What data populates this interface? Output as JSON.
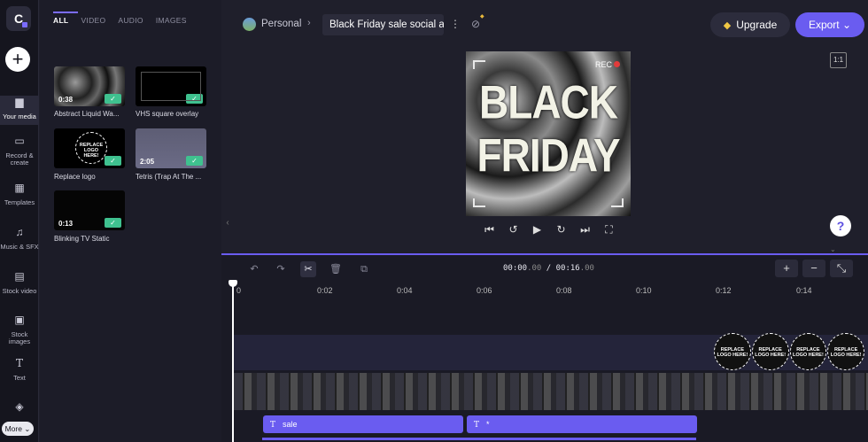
{
  "rail": {
    "logo": "C",
    "items": [
      {
        "label": "Your media",
        "icon": "folder-icon"
      },
      {
        "label": "Record & create",
        "icon": "camera-icon"
      },
      {
        "label": "Templates",
        "icon": "grid-icon"
      },
      {
        "label": "Music & SFX",
        "icon": "music-icon"
      },
      {
        "label": "Stock video",
        "icon": "film-icon"
      },
      {
        "label": "Stock images",
        "icon": "image-icon"
      },
      {
        "label": "Text",
        "icon": "text-icon"
      },
      {
        "label": "",
        "icon": "shapes-icon"
      }
    ],
    "more": "More ⌄"
  },
  "panel": {
    "tabs": [
      "ALL",
      "VIDEO",
      "AUDIO",
      "IMAGES"
    ],
    "media": [
      {
        "name": "Abstract Liquid Wa...",
        "duration": "0:38"
      },
      {
        "name": "VHS square overlay",
        "duration": ""
      },
      {
        "name": "Replace logo",
        "duration": "",
        "overlay": "REPLACE LOGO HERE!"
      },
      {
        "name": "Tetris (Trap At The ...",
        "duration": "2:05"
      },
      {
        "name": "Blinking TV Static",
        "duration": "0:13"
      }
    ]
  },
  "topbar": {
    "project": "Personal",
    "crumb_sep": "›",
    "title": "Black Friday sale social a",
    "upgrade": "Upgrade",
    "export": "Export ⌄",
    "ratio": "1:1"
  },
  "preview": {
    "line1": "BLACK",
    "line2": "FRIDAY",
    "rec": "REC"
  },
  "timeline": {
    "time_current": "00:00",
    "time_current_ms": ".00",
    "time_sep": " / ",
    "time_total": "00:16",
    "time_total_ms": ".00",
    "ticks": [
      "0",
      "0:02",
      "0:04",
      "0:06",
      "0:08",
      "0:10",
      "0:12",
      "0:14"
    ],
    "logo_overlay": "REPLACE LOGO HERE!",
    "text_clips": [
      {
        "label": "sale"
      },
      {
        "label": "*"
      }
    ]
  },
  "help": "?",
  "colors": {
    "accent": "#6a5cf0",
    "check": "#3fc18f",
    "upgrade_gem": "#f0c744"
  }
}
